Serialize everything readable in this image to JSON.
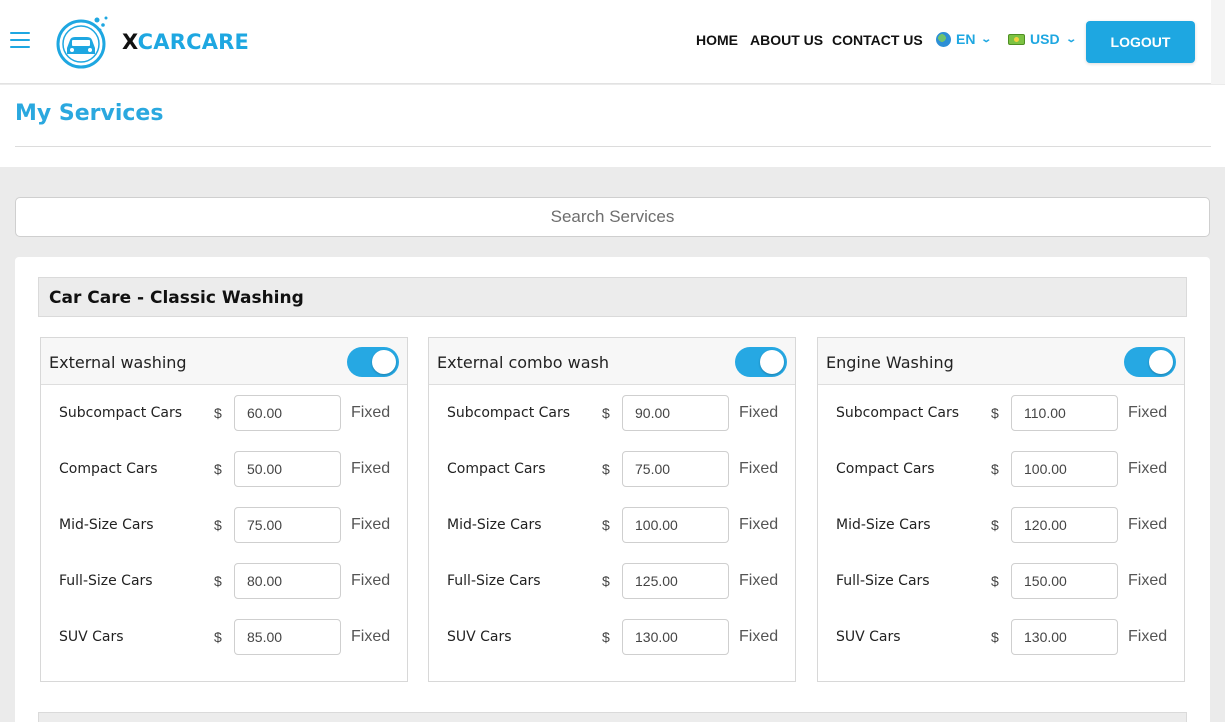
{
  "header": {
    "logo": {
      "x": "X",
      "rest": "CARCARE"
    },
    "nav": {
      "home": "HOME",
      "about": "ABOUT US",
      "contact": "CONTACT US"
    },
    "language": "EN",
    "currency": "USD",
    "logout_label": "LOGOUT",
    "icons": {
      "menu": "hamburger-menu-icon",
      "language": "globe-icon",
      "currency": "cash-icon"
    },
    "accent_color": "#1ea7e1"
  },
  "page": {
    "title": "My Services"
  },
  "search": {
    "placeholder": "Search Services",
    "value": ""
  },
  "category": {
    "title": "Car Care - Classic Washing",
    "services": [
      {
        "name": "External washing",
        "enabled": true,
        "prices": [
          {
            "label": "Subcompact Cars",
            "currency": "$",
            "value": "60.00",
            "type": "Fixed"
          },
          {
            "label": "Compact Cars",
            "currency": "$",
            "value": "50.00",
            "type": "Fixed"
          },
          {
            "label": "Mid-Size Cars",
            "currency": "$",
            "value": "75.00",
            "type": "Fixed"
          },
          {
            "label": "Full-Size Cars",
            "currency": "$",
            "value": "80.00",
            "type": "Fixed"
          },
          {
            "label": "SUV Cars",
            "currency": "$",
            "value": "85.00",
            "type": "Fixed"
          }
        ]
      },
      {
        "name": "External combo wash",
        "enabled": true,
        "prices": [
          {
            "label": "Subcompact Cars",
            "currency": "$",
            "value": "90.00",
            "type": "Fixed"
          },
          {
            "label": "Compact Cars",
            "currency": "$",
            "value": "75.00",
            "type": "Fixed"
          },
          {
            "label": "Mid-Size Cars",
            "currency": "$",
            "value": "100.00",
            "type": "Fixed"
          },
          {
            "label": "Full-Size Cars",
            "currency": "$",
            "value": "125.00",
            "type": "Fixed"
          },
          {
            "label": "SUV Cars",
            "currency": "$",
            "value": "130.00",
            "type": "Fixed"
          }
        ]
      },
      {
        "name": "Engine Washing",
        "enabled": true,
        "prices": [
          {
            "label": "Subcompact Cars",
            "currency": "$",
            "value": "110.00",
            "type": "Fixed"
          },
          {
            "label": "Compact Cars",
            "currency": "$",
            "value": "100.00",
            "type": "Fixed"
          },
          {
            "label": "Mid-Size Cars",
            "currency": "$",
            "value": "120.00",
            "type": "Fixed"
          },
          {
            "label": "Full-Size Cars",
            "currency": "$",
            "value": "150.00",
            "type": "Fixed"
          },
          {
            "label": "SUV Cars",
            "currency": "$",
            "value": "130.00",
            "type": "Fixed"
          }
        ]
      }
    ]
  }
}
